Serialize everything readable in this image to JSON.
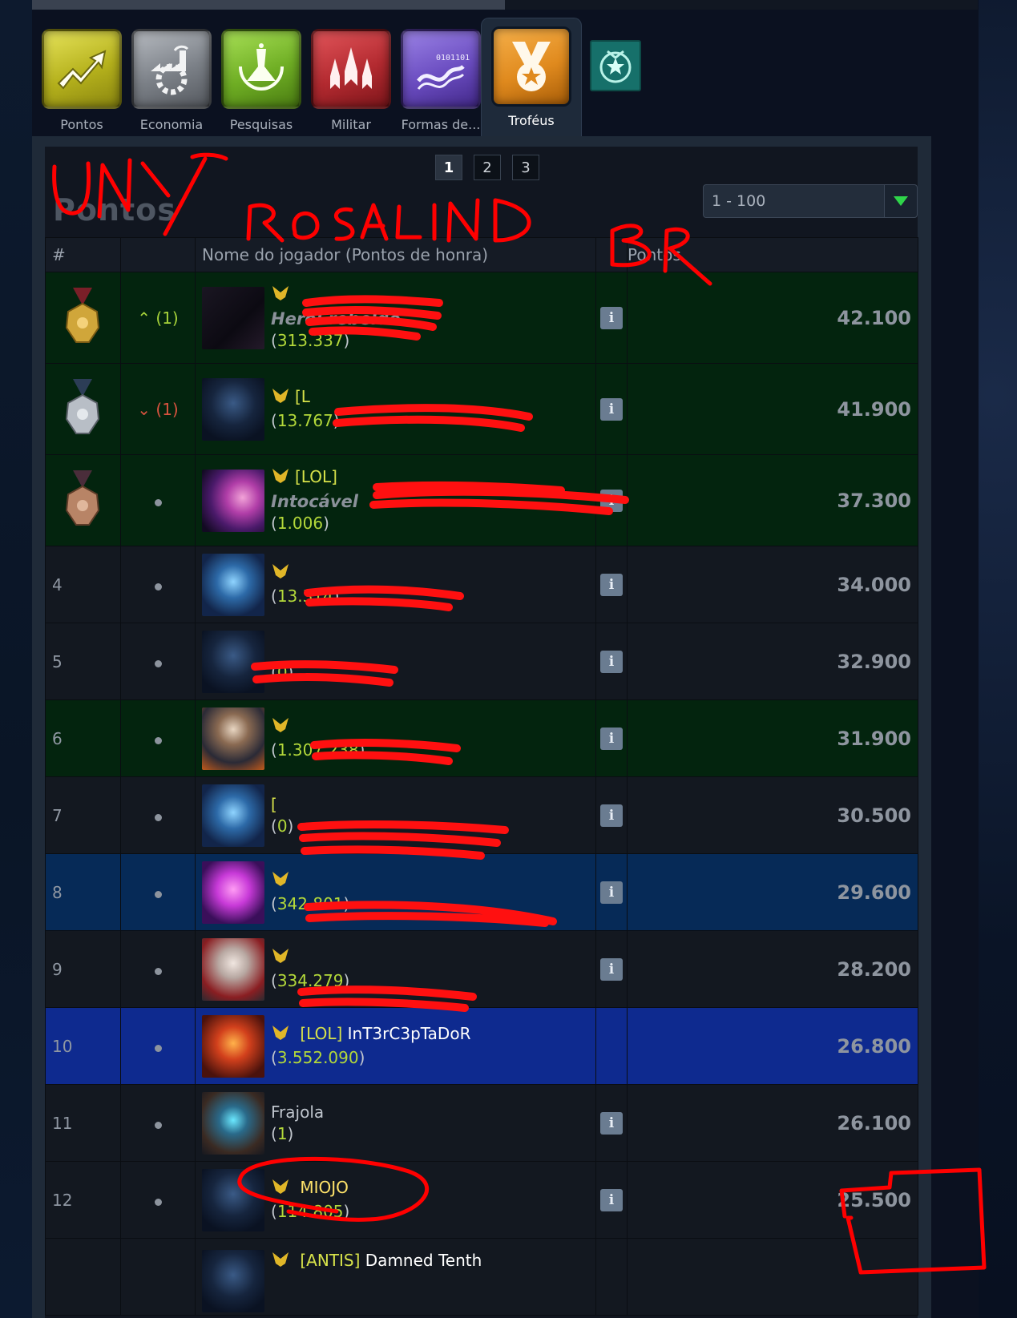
{
  "tabs": [
    {
      "label": "Pontos",
      "icon": "points-trend-icon",
      "color": "#c9c62a"
    },
    {
      "label": "Economia",
      "icon": "factory-gear-icon",
      "color": "#8f9399"
    },
    {
      "label": "Pesquisas",
      "icon": "flask-laurel-icon",
      "color": "#7fbf2e"
    },
    {
      "label": "Militar",
      "icon": "fighter-ships-icon",
      "color": "#c0363a"
    },
    {
      "label": "Formas de...",
      "icon": "dna-lifeform-icon",
      "color": "#6d4fbf"
    },
    {
      "label": "Troféus",
      "icon": "trophy-medal-icon",
      "color": "#e08a1e",
      "active": true
    }
  ],
  "extra_icon": "alliance-emblem-icon",
  "pager": {
    "pages": [
      "1",
      "2",
      "3"
    ],
    "current": "1"
  },
  "section_title": "Pontos",
  "range_select": {
    "value": "1 - 100"
  },
  "table": {
    "headers": {
      "rank": "#",
      "change": "",
      "name": "Nome do jogador (Pontos de honra)",
      "info": "",
      "points": "Pontos"
    },
    "rows": [
      {
        "rank": "",
        "medal": "gold",
        "change": "up",
        "change_text": "(1)",
        "alliance": "",
        "name": "",
        "title": "Herói rebelde",
        "honor": "313.337",
        "points": "42.100",
        "bg": "green",
        "info": true
      },
      {
        "rank": "",
        "medal": "silver",
        "change": "down",
        "change_text": "(1)",
        "alliance": "[L",
        "name": "",
        "title": "",
        "honor": "13.767",
        "points": "41.900",
        "bg": "green",
        "info": true
      },
      {
        "rank": "",
        "medal": "bronze",
        "change": "same",
        "change_text": "",
        "alliance": "[LOL]",
        "name": "",
        "title": "Intocável",
        "honor": "1.006",
        "points": "37.300",
        "bg": "green",
        "info": true
      },
      {
        "rank": "4",
        "medal": "",
        "change": "same",
        "change_text": "",
        "alliance": "",
        "name": "",
        "title": "",
        "honor": "13.314",
        "points": "34.000",
        "bg": "dark",
        "info": true
      },
      {
        "rank": "5",
        "medal": "",
        "change": "same",
        "change_text": "",
        "alliance": "",
        "name": "",
        "title": "",
        "honor": "0",
        "points": "32.900",
        "bg": "dark",
        "info": true
      },
      {
        "rank": "6",
        "medal": "",
        "change": "same",
        "change_text": "",
        "alliance": "",
        "name": "",
        "title": "",
        "honor": "1.307.238",
        "points": "31.900",
        "bg": "green",
        "info": true
      },
      {
        "rank": "7",
        "medal": "",
        "change": "same",
        "change_text": "",
        "alliance": "[",
        "name": "",
        "title": "",
        "honor": "0",
        "points": "30.500",
        "bg": "dark",
        "info": true
      },
      {
        "rank": "8",
        "medal": "",
        "change": "same",
        "change_text": "",
        "alliance": "",
        "name": "",
        "title": "",
        "honor": "342.801",
        "points": "29.600",
        "bg": "navy",
        "info": true
      },
      {
        "rank": "9",
        "medal": "",
        "change": "same",
        "change_text": "",
        "alliance": "",
        "name": "",
        "title": "",
        "honor": "334.279",
        "points": "28.200",
        "bg": "dark",
        "info": true
      },
      {
        "rank": "10",
        "medal": "",
        "change": "same",
        "change_text": "",
        "alliance": "[LOL]",
        "name": "InT3rC3pTaDoR",
        "title": "",
        "honor": "3.552.090",
        "points": "26.800",
        "bg": "blue",
        "info": false
      },
      {
        "rank": "11",
        "medal": "",
        "change": "same",
        "change_text": "",
        "alliance": "",
        "name": "Frajola",
        "title": "",
        "honor": "1",
        "points": "26.100",
        "bg": "dark",
        "info": true
      },
      {
        "rank": "12",
        "medal": "",
        "change": "same",
        "change_text": "",
        "alliance": "",
        "name": "MIOJO",
        "title": "",
        "honor": "114.805",
        "points": "25.500",
        "bg": "dark",
        "info": true
      },
      {
        "rank": "",
        "medal": "",
        "change": "same",
        "change_text": "",
        "alliance": "[ANTIS]",
        "name": "Damned Tenth",
        "title": "",
        "honor": "",
        "points": "",
        "bg": "dark",
        "info": false
      }
    ]
  },
  "annotations": {
    "handwritten_1": "UNY",
    "handwritten_2": "ROSALIND",
    "handwritten_3": "BR",
    "ink_color": "#ff0000"
  }
}
